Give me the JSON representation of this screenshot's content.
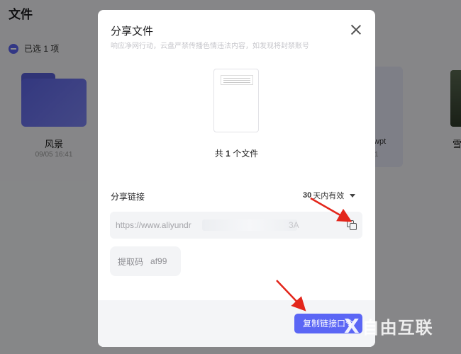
{
  "background": {
    "title": "文件",
    "selected_text": "已选 1 项",
    "files": [
      {
        "name": "风景",
        "date": "09/05 16:41"
      },
      {
        "name": ".wpt",
        "date": "1"
      },
      {
        "name": "雪",
        "date": ""
      }
    ]
  },
  "modal": {
    "title": "分享文件",
    "subtitle": "响应净网行动，云盘严禁传播色情违法内容，如发现将封禁账号",
    "file_count_prefix": "共",
    "file_count_num": "1",
    "file_count_suffix": "个文件",
    "link_label": "分享链接",
    "validity_days": "30",
    "validity_suffix": "天内有效",
    "link_value": "https://www.aliyundr",
    "link_tail": "3A",
    "code_label": "提取码",
    "code_value": "af99",
    "primary_button": "复制链接口令"
  },
  "watermark": {
    "text": "自由互联",
    "mark": "X"
  },
  "colors": {
    "accent": "#5b66f5",
    "overlay": "rgba(0,0,0,0.45)",
    "arrow": "#e3261b"
  }
}
